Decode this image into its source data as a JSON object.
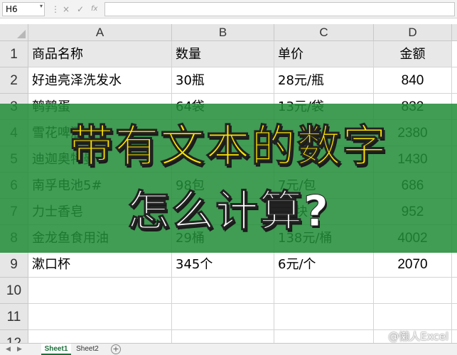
{
  "formula_bar": {
    "name_box": "H6",
    "cancel_glyph": "×",
    "enter_glyph": "✓",
    "function_glyph": "fx",
    "formula": ""
  },
  "grid": {
    "columns": [
      "A",
      "B",
      "C",
      "D"
    ],
    "rows": [
      "1",
      "2",
      "3",
      "4",
      "5",
      "6",
      "7",
      "8",
      "9",
      "10",
      "11",
      "12"
    ],
    "header_row": [
      "商品名称",
      "数量",
      "单价",
      "金额"
    ],
    "data_rows": [
      [
        "好迪亮泽洗发水",
        "30瓶",
        "28元/瓶",
        "840"
      ],
      [
        "鹌鹑蛋",
        "64袋",
        "13元/袋",
        "832"
      ],
      [
        "雪花啤酒",
        "",
        "",
        "2380"
      ],
      [
        "迪迦奥特曼",
        "",
        "",
        "1430"
      ],
      [
        "南孚电池5#",
        "98包",
        "7元/包",
        "686"
      ],
      [
        "力士香皂",
        "",
        "元/块",
        "952"
      ],
      [
        "金龙鱼食用油",
        "29桶",
        "138元/桶",
        "4002"
      ],
      [
        "漱口杯",
        "345个",
        "6元/个",
        "2070"
      ]
    ]
  },
  "overlay": {
    "title": "带有文本的数字",
    "subtitle": "怎么计算?",
    "color": "#228c38"
  },
  "sheet_tabs": {
    "tabs": [
      "Sheet1",
      "Sheet2"
    ],
    "active": "Sheet1",
    "add_glyph": "+"
  },
  "watermark": "@懒人Excel"
}
